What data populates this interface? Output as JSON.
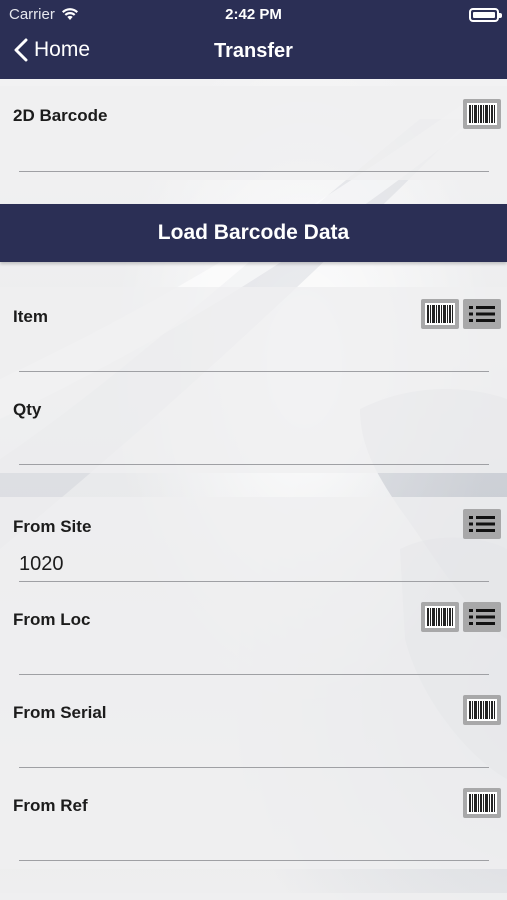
{
  "status_bar": {
    "carrier": "Carrier",
    "time": "2:42 PM"
  },
  "nav": {
    "back_label": "Home",
    "title": "Transfer"
  },
  "barcode_section": {
    "label": "2D Barcode",
    "value": ""
  },
  "load_button": "Load Barcode Data",
  "fields": {
    "item": {
      "label": "Item",
      "value": ""
    },
    "qty": {
      "label": "Qty",
      "value": ""
    },
    "from_site": {
      "label": "From Site",
      "value": "1020"
    },
    "from_loc": {
      "label": "From Loc",
      "value": ""
    },
    "from_serial": {
      "label": "From Serial",
      "value": ""
    },
    "from_ref": {
      "label": "From Ref",
      "value": ""
    }
  },
  "colors": {
    "nav_background": "#2b2f55",
    "icon_button": "#a8a8a9"
  },
  "icons": [
    "wifi-icon",
    "battery-icon",
    "back-chevron-icon",
    "barcode-icon",
    "list-icon"
  ]
}
